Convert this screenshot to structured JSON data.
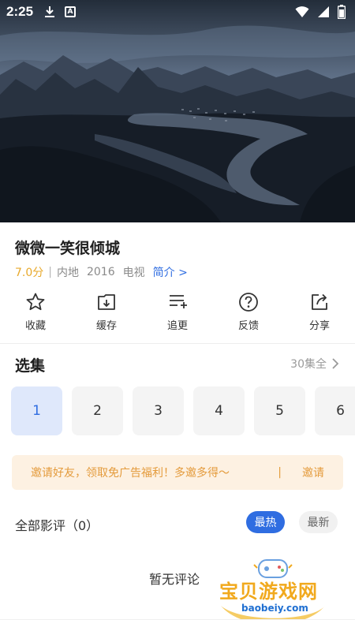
{
  "status_bar": {
    "time": "2:25",
    "icons": [
      "download-icon",
      "a-box-icon",
      "wifi-icon",
      "signal-icon",
      "battery-icon"
    ]
  },
  "video": {
    "description_icon": "video-frame"
  },
  "info": {
    "title": "微微一笑很倾城",
    "score": "7.0分",
    "separator": "|",
    "region": "内地",
    "year": "2016",
    "type": "电视",
    "intro_link": "简介 >"
  },
  "actions": [
    {
      "label": "收藏",
      "icon": "star-icon"
    },
    {
      "label": "缓存",
      "icon": "download-box-icon"
    },
    {
      "label": "追更",
      "icon": "list-add-icon"
    },
    {
      "label": "反馈",
      "icon": "help-circle-icon"
    },
    {
      "label": "分享",
      "icon": "share-icon"
    }
  ],
  "episodes": {
    "title": "选集",
    "total": "30集全",
    "items": [
      "1",
      "2",
      "3",
      "4",
      "5",
      "6"
    ],
    "selected": "1"
  },
  "invite": {
    "text": "邀请好友，领取免广告福利！多邀多得～",
    "divider": "|",
    "button": "邀请"
  },
  "comments": {
    "header": "全部影评（0）",
    "tab_hot": "最热",
    "tab_new": "最新",
    "empty_text": "暂无评论"
  },
  "watermark": {
    "text": "宝贝游戏网",
    "url": "baobeiy.com"
  },
  "colors": {
    "accent": "#2f6de1",
    "score": "#e8a92b",
    "invite_bg": "#fdf1e2",
    "invite_text": "#e49b3c"
  }
}
